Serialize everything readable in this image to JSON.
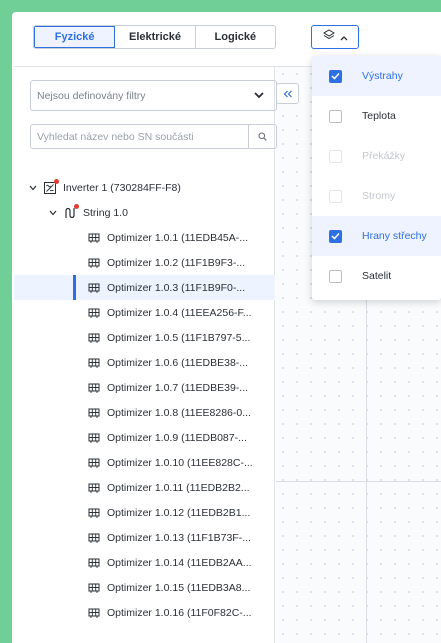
{
  "tabs": [
    {
      "label": "Fyzické",
      "active": true
    },
    {
      "label": "Elektrické",
      "active": false
    },
    {
      "label": "Logické",
      "active": false
    }
  ],
  "layers_button": {
    "icon": "layers-icon",
    "chevron": "chevron-up-icon"
  },
  "sidebar": {
    "filter_select": {
      "value": "Nejsou definovány filtry",
      "icon": "chevron-down-icon"
    },
    "search": {
      "placeholder": "Vyhledat název nebo SN součásti",
      "icon": "search-icon"
    },
    "tree": {
      "inverter": {
        "label": "Inverter 1 (730284FF-F8)",
        "icon": "inverter-icon",
        "alert": true
      },
      "string": {
        "label": "String 1.0",
        "icon": "string-icon",
        "alert": true
      },
      "optimizers": [
        {
          "label": "Optimizer 1.0.1 (11EDB45A-...",
          "selected": false
        },
        {
          "label": "Optimizer 1.0.2 (11F1B9F3-...",
          "selected": false
        },
        {
          "label": "Optimizer 1.0.3 (11F1B9F0-...",
          "selected": true
        },
        {
          "label": "Optimizer 1.0.4 (11EEA256-F...",
          "selected": false
        },
        {
          "label": "Optimizer 1.0.5 (11F1B797-5...",
          "selected": false
        },
        {
          "label": "Optimizer 1.0.6 (11EDBE38-...",
          "selected": false
        },
        {
          "label": "Optimizer 1.0.7 (11EDBE39-...",
          "selected": false
        },
        {
          "label": "Optimizer 1.0.8 (11EE8286-0...",
          "selected": false
        },
        {
          "label": "Optimizer 1.0.9 (11EDB087-...",
          "selected": false
        },
        {
          "label": "Optimizer 1.0.10 (11EE828C-...",
          "selected": false
        },
        {
          "label": "Optimizer 1.0.11 (11EDB2B2...",
          "selected": false
        },
        {
          "label": "Optimizer 1.0.12 (11EDB2B1...",
          "selected": false
        },
        {
          "label": "Optimizer 1.0.13 (11F1B73F-...",
          "selected": false
        },
        {
          "label": "Optimizer 1.0.14 (11EDB2AA...",
          "selected": false
        },
        {
          "label": "Optimizer 1.0.15 (11EDB3A8...",
          "selected": false
        },
        {
          "label": "Optimizer 1.0.16 (11F0F82C-...",
          "selected": false
        }
      ]
    }
  },
  "collapse_button": {
    "label": "«"
  },
  "layers_dropdown": [
    {
      "label": "Výstrahy",
      "checked": true,
      "disabled": false
    },
    {
      "label": "Teplota",
      "checked": false,
      "disabled": false
    },
    {
      "label": "Překážky",
      "checked": false,
      "disabled": true
    },
    {
      "label": "Stromy",
      "checked": false,
      "disabled": true
    },
    {
      "label": "Hrany střechy",
      "checked": true,
      "disabled": false
    },
    {
      "label": "Satelit",
      "checked": false,
      "disabled": false
    }
  ],
  "colors": {
    "accent": "#2f6fe4",
    "frame": "#6fcf97",
    "alert": "#e23a2e"
  }
}
